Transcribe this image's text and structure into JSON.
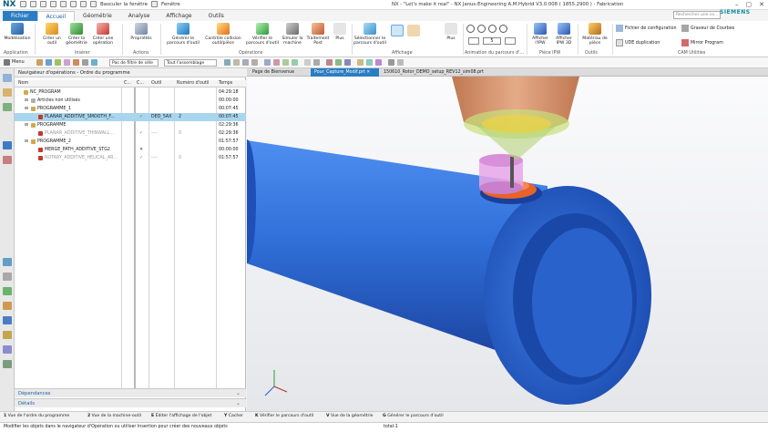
{
  "app": {
    "logo": "NX",
    "window_title": "NX - \"Let's make it real\" - NX Janus-Engineering A.M.Hybrid V3.0.008 ( 1855.2900 ) - Fabrication",
    "brand": "SIEMENS",
    "quick_access": {
      "switch_window": "Basculer la fenêtre",
      "window": "Fenêtre"
    }
  },
  "menu": {
    "tabs": [
      "Fichier",
      "Accueil",
      "Géométrie",
      "Analyse",
      "Affichage",
      "Outils"
    ],
    "active": "Accueil",
    "search_placeholder": "Rechercher une co..."
  },
  "ribbon": {
    "buttons": [
      {
        "label": "Modélisation",
        "icon": "modeling-icon"
      },
      {
        "label": "Créer un outil",
        "icon": "create-tool-icon"
      },
      {
        "label": "Créer la géométrie",
        "icon": "create-geometry-icon"
      },
      {
        "label": "Créer une opération",
        "icon": "create-operation-icon"
      },
      {
        "label": "Propriétés",
        "icon": "properties-icon"
      },
      {
        "label": "Générer le parcours d'outil",
        "icon": "generate-toolpath-icon"
      },
      {
        "label": "Contrôle collision outil/pièce",
        "icon": "collision-check-icon"
      },
      {
        "label": "Vérifier le parcours d'outil",
        "icon": "verify-toolpath-icon"
      },
      {
        "label": "Simuler la machine",
        "icon": "simulate-machine-icon"
      },
      {
        "label": "Traitement Post",
        "icon": "postprocess-icon"
      },
      {
        "label": "Plus",
        "icon": "more-icon"
      },
      {
        "label": "Sélectionner le parcours d'outil",
        "icon": "select-toolpath-icon"
      },
      {
        "label": "Plus",
        "icon": "more-icon"
      },
      {
        "label": "Afficher l'IPW",
        "icon": "show-ipw-icon"
      },
      {
        "label": "Afficher IPW 3D",
        "icon": "show-ipw-3d-icon"
      },
      {
        "label": "Matériau de pièce",
        "icon": "material-icon"
      },
      {
        "label": "Fichier de configuration",
        "icon": "config-file-icon"
      },
      {
        "label": "Graveur de Courbes",
        "icon": "curve-engraver-icon"
      },
      {
        "label": "UDE duplication",
        "icon": "ude-duplication-icon"
      },
      {
        "label": "Mirror Program",
        "icon": "mirror-program-icon"
      }
    ],
    "groups": [
      "Application",
      "Insérer",
      "Actions",
      "Opérations",
      "Affichage",
      "Animation du parcours d'...",
      "Pièce IPW",
      "Outils",
      "CAM Utilities"
    ],
    "anim_speed": "5"
  },
  "toolbar2": {
    "menu_label": "Menu",
    "filter": "Pas de filtre de séle",
    "assembly": "Tout l'assemblage"
  },
  "navigator": {
    "title": "Navigateur d'opérations - Ordre du programme",
    "columns": [
      "Nom",
      "C...",
      "C...",
      "Outil",
      "Numéro d'outil",
      "Temps"
    ],
    "rows": [
      {
        "name": "NC_PROGRAM",
        "c1": "",
        "c2": "",
        "tool": "",
        "num": "",
        "time": "04:29:18",
        "indent": 0,
        "state": "normal"
      },
      {
        "name": "Articles non utilisés",
        "c1": "",
        "c2": "",
        "tool": "",
        "num": "",
        "time": "00:00:00",
        "indent": 1,
        "state": "normal"
      },
      {
        "name": "PROGRAMME_1",
        "c1": "",
        "c2": "",
        "tool": "",
        "num": "",
        "time": "00:07:45",
        "indent": 1,
        "state": "normal"
      },
      {
        "name": "PLANAR_ADDITIVE_SMOOTH_F...",
        "c1": "",
        "c2": "✓",
        "tool": "DED_5AX",
        "num": "2",
        "time": "00:07:45",
        "indent": 2,
        "state": "selected"
      },
      {
        "name": "PROGRAMME",
        "c1": "",
        "c2": "",
        "tool": "",
        "num": "",
        "time": "02:29:36",
        "indent": 1,
        "state": "normal"
      },
      {
        "name": "PLANAR_ADDITIVE_THINWALL...",
        "c1": "",
        "c2": "✓",
        "tool": "----",
        "num": "0",
        "time": "02:29:36",
        "indent": 2,
        "state": "disabled"
      },
      {
        "name": "PROGRAMME_2",
        "c1": "",
        "c2": "",
        "tool": "",
        "num": "",
        "time": "01:57:57",
        "indent": 1,
        "state": "normal"
      },
      {
        "name": "MERGE_PATH_ADDITIVE_STG2",
        "c1": "",
        "c2": "✕",
        "tool": "",
        "num": "",
        "time": "00:00:00",
        "indent": 2,
        "state": "normal"
      },
      {
        "name": "ROTARY_ADDITIVE_HELICAL_AR...",
        "c1": "",
        "c2": "✓",
        "tool": "----",
        "num": "0",
        "time": "01:57:57",
        "indent": 2,
        "state": "disabled"
      }
    ],
    "panels": [
      "Dépendances",
      "Détails"
    ]
  },
  "viewport_tabs": [
    {
      "label": "Page de Bienvenue",
      "active": false
    },
    {
      "label": "Pour_Capture_Modif.prt",
      "active": true
    },
    {
      "label": "150610_Rotor_DEMO_setup_REV12_sim08.prt",
      "active": false
    }
  ],
  "bottom_toolbar": [
    "Vue de l'ordre du programme",
    "Vue de la machine-outil",
    "Éditer l'affichage de l'objet",
    "Cacher",
    "Vérifier le parcours d'outil",
    "Vue de la géométrie",
    "Générer le parcours d'outil"
  ],
  "bottom_toolbar_keys": [
    "1",
    "2",
    "E",
    "Y",
    "K",
    "V",
    "G"
  ],
  "status": {
    "message": "Modifier les objets dans le navigateur d'Opération ou utiliser Insertion pour créer des nouveaux objets",
    "right": "total-1"
  },
  "colors": {
    "accent": "#2a7dc2",
    "pipe": "#2f6fd8",
    "nozzle": "#d78a5a",
    "deposit": "#e8622a"
  }
}
